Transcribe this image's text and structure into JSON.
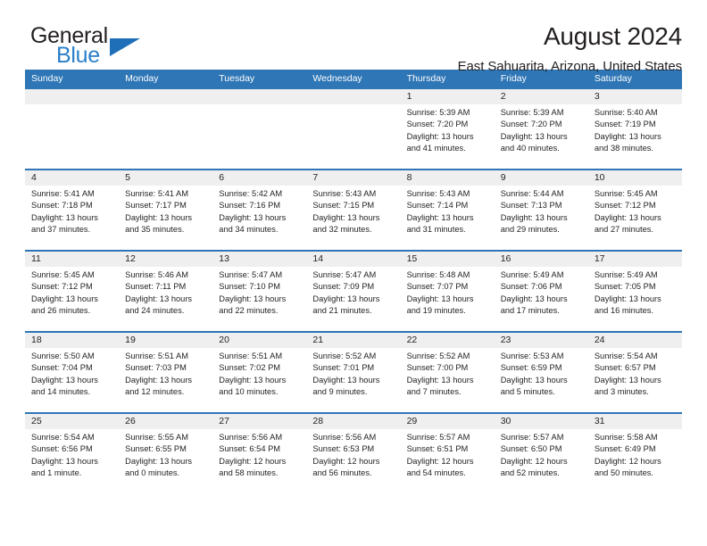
{
  "brand": {
    "name_part1": "General",
    "name_part2": "Blue",
    "flag_color": "#1f6fb8"
  },
  "header": {
    "title": "August 2024",
    "subtitle": "East Sahuarita, Arizona, United States",
    "accent_color": "#2e76b6",
    "daynum_band_color": "#efefef"
  },
  "weekdays": [
    "Sunday",
    "Monday",
    "Tuesday",
    "Wednesday",
    "Thursday",
    "Friday",
    "Saturday"
  ],
  "calendar": {
    "weeks": [
      {
        "nums": [
          "",
          "",
          "",
          "",
          "1",
          "2",
          "3"
        ],
        "info": [
          "",
          "",
          "",
          "",
          "Sunrise: 5:39 AM\nSunset: 7:20 PM\nDaylight: 13 hours\nand 41 minutes.",
          "Sunrise: 5:39 AM\nSunset: 7:20 PM\nDaylight: 13 hours\nand 40 minutes.",
          "Sunrise: 5:40 AM\nSunset: 7:19 PM\nDaylight: 13 hours\nand 38 minutes."
        ]
      },
      {
        "nums": [
          "4",
          "5",
          "6",
          "7",
          "8",
          "9",
          "10"
        ],
        "info": [
          "Sunrise: 5:41 AM\nSunset: 7:18 PM\nDaylight: 13 hours\nand 37 minutes.",
          "Sunrise: 5:41 AM\nSunset: 7:17 PM\nDaylight: 13 hours\nand 35 minutes.",
          "Sunrise: 5:42 AM\nSunset: 7:16 PM\nDaylight: 13 hours\nand 34 minutes.",
          "Sunrise: 5:43 AM\nSunset: 7:15 PM\nDaylight: 13 hours\nand 32 minutes.",
          "Sunrise: 5:43 AM\nSunset: 7:14 PM\nDaylight: 13 hours\nand 31 minutes.",
          "Sunrise: 5:44 AM\nSunset: 7:13 PM\nDaylight: 13 hours\nand 29 minutes.",
          "Sunrise: 5:45 AM\nSunset: 7:12 PM\nDaylight: 13 hours\nand 27 minutes."
        ]
      },
      {
        "nums": [
          "11",
          "12",
          "13",
          "14",
          "15",
          "16",
          "17"
        ],
        "info": [
          "Sunrise: 5:45 AM\nSunset: 7:12 PM\nDaylight: 13 hours\nand 26 minutes.",
          "Sunrise: 5:46 AM\nSunset: 7:11 PM\nDaylight: 13 hours\nand 24 minutes.",
          "Sunrise: 5:47 AM\nSunset: 7:10 PM\nDaylight: 13 hours\nand 22 minutes.",
          "Sunrise: 5:47 AM\nSunset: 7:09 PM\nDaylight: 13 hours\nand 21 minutes.",
          "Sunrise: 5:48 AM\nSunset: 7:07 PM\nDaylight: 13 hours\nand 19 minutes.",
          "Sunrise: 5:49 AM\nSunset: 7:06 PM\nDaylight: 13 hours\nand 17 minutes.",
          "Sunrise: 5:49 AM\nSunset: 7:05 PM\nDaylight: 13 hours\nand 16 minutes."
        ]
      },
      {
        "nums": [
          "18",
          "19",
          "20",
          "21",
          "22",
          "23",
          "24"
        ],
        "info": [
          "Sunrise: 5:50 AM\nSunset: 7:04 PM\nDaylight: 13 hours\nand 14 minutes.",
          "Sunrise: 5:51 AM\nSunset: 7:03 PM\nDaylight: 13 hours\nand 12 minutes.",
          "Sunrise: 5:51 AM\nSunset: 7:02 PM\nDaylight: 13 hours\nand 10 minutes.",
          "Sunrise: 5:52 AM\nSunset: 7:01 PM\nDaylight: 13 hours\nand 9 minutes.",
          "Sunrise: 5:52 AM\nSunset: 7:00 PM\nDaylight: 13 hours\nand 7 minutes.",
          "Sunrise: 5:53 AM\nSunset: 6:59 PM\nDaylight: 13 hours\nand 5 minutes.",
          "Sunrise: 5:54 AM\nSunset: 6:57 PM\nDaylight: 13 hours\nand 3 minutes."
        ]
      },
      {
        "nums": [
          "25",
          "26",
          "27",
          "28",
          "29",
          "30",
          "31"
        ],
        "info": [
          "Sunrise: 5:54 AM\nSunset: 6:56 PM\nDaylight: 13 hours\nand 1 minute.",
          "Sunrise: 5:55 AM\nSunset: 6:55 PM\nDaylight: 13 hours\nand 0 minutes.",
          "Sunrise: 5:56 AM\nSunset: 6:54 PM\nDaylight: 12 hours\nand 58 minutes.",
          "Sunrise: 5:56 AM\nSunset: 6:53 PM\nDaylight: 12 hours\nand 56 minutes.",
          "Sunrise: 5:57 AM\nSunset: 6:51 PM\nDaylight: 12 hours\nand 54 minutes.",
          "Sunrise: 5:57 AM\nSunset: 6:50 PM\nDaylight: 12 hours\nand 52 minutes.",
          "Sunrise: 5:58 AM\nSunset: 6:49 PM\nDaylight: 12 hours\nand 50 minutes."
        ]
      }
    ]
  }
}
